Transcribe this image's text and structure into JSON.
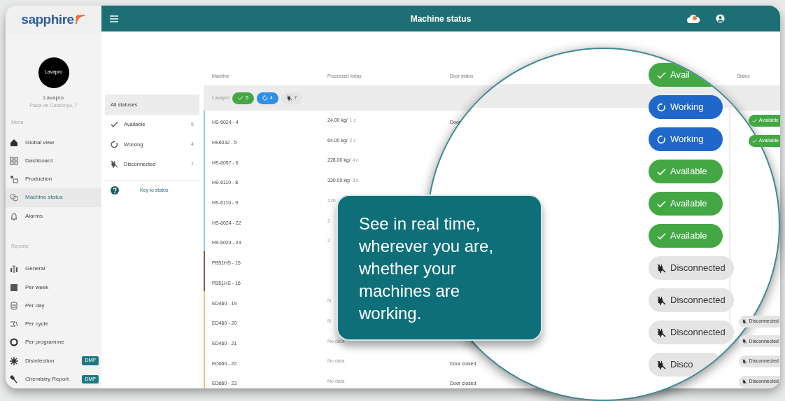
{
  "app": {
    "logo": "sapphire"
  },
  "header": {
    "title": "Machine status"
  },
  "account": {
    "avatar_label": "Lavapro",
    "name": "Lavapro",
    "address": "Plaça de Catalunya, 7"
  },
  "sidebar": {
    "sections": [
      {
        "title": "Menu",
        "items": [
          {
            "label": "Global view",
            "selected": false
          },
          {
            "label": "Dashboard",
            "selected": false
          },
          {
            "label": "Production",
            "selected": false
          },
          {
            "label": "Machine status",
            "selected": true
          },
          {
            "label": "Alarms",
            "selected": false
          }
        ]
      },
      {
        "title": "Reports",
        "items": [
          {
            "label": "General",
            "selected": false
          },
          {
            "label": "Per week",
            "selected": false
          },
          {
            "label": "Per day",
            "selected": false
          },
          {
            "label": "Per cycle",
            "selected": false
          },
          {
            "label": "Per programme",
            "selected": false
          },
          {
            "label": "Disinfection",
            "badge": "DMP",
            "selected": false
          },
          {
            "label": "Chemistry Report",
            "badge": "DMP",
            "selected": false
          }
        ]
      }
    ]
  },
  "filter": {
    "items": [
      {
        "label": "All statuses",
        "kind": "all",
        "selected": true
      },
      {
        "label": "Available",
        "kind": "available",
        "count": "5",
        "selected": false
      },
      {
        "label": "Working",
        "kind": "working",
        "count": "4",
        "selected": false
      },
      {
        "label": "Disconnected",
        "kind": "disconnected",
        "count": "7",
        "selected": false
      }
    ],
    "help": "Key to status"
  },
  "table": {
    "columns": [
      "Machine",
      "Processed today",
      "Door status",
      "Status"
    ],
    "group": {
      "name": "Lavapro",
      "chips": [
        {
          "kind": "available",
          "count": "5"
        },
        {
          "kind": "working",
          "count": "4"
        },
        {
          "kind": "disconnected",
          "count": "7"
        }
      ]
    },
    "rows": [
      {
        "machine": "HS-6024 - 4",
        "processed": "24.00 kg/",
        "cycles": "1 c",
        "door": "Door",
        "status": {
          "kind": "available",
          "label": "Available"
        },
        "color": "#90c4f0"
      },
      {
        "machine": "HS6032 - 5",
        "processed": "64.00 kg/",
        "cycles": "2 c",
        "status": {
          "kind": "available",
          "label": "Available"
        },
        "color": "#90c4f0"
      },
      {
        "machine": "HS-6057 - 6",
        "processed": "228.00 kg/",
        "cycles": "4 c",
        "color": "#90c4f0"
      },
      {
        "machine": "HS-6110 - 8",
        "processed": "330.00 kg/",
        "cycles": "3 c",
        "color": "#90c4f0"
      },
      {
        "machine": "HS-6110 - 9",
        "processed": "220",
        "color": "#90c4f0"
      },
      {
        "machine": "HS-6024 - 22",
        "processed": "2",
        "color": "#90c4f0"
      },
      {
        "machine": "HS-6024 - 23",
        "processed": "2",
        "color": "#90c4f0"
      },
      {
        "machine": "PB51HS - 15",
        "color": "#7a5c55"
      },
      {
        "machine": "PB51HS - 16",
        "color": "#7a5c55"
      },
      {
        "machine": "ED460 - 19",
        "processed": "N",
        "color": "#f2c27a"
      },
      {
        "machine": "ED460 - 20",
        "processed": "N",
        "status": {
          "kind": "disconnected",
          "label": "Disconnected"
        },
        "color": "#f2c27a"
      },
      {
        "machine": "ED460 - 21",
        "processed": "No data",
        "status": {
          "kind": "disconnected",
          "label": "Disconnected"
        },
        "color": "#f2c27a"
      },
      {
        "machine": "ED660 - 22",
        "processed": "No data",
        "door": "Door closed",
        "status": {
          "kind": "disconnected",
          "label": "Disconnected"
        },
        "color": "#f2c27a"
      },
      {
        "machine": "ED660 - 23",
        "processed": "No data",
        "door": "Door closed",
        "status": {
          "kind": "disconnected",
          "label": "Disconnected"
        },
        "color": "#f2c27a"
      }
    ]
  },
  "magnifier": {
    "statuses": [
      {
        "kind": "available",
        "label": "Avail"
      },
      {
        "kind": "working",
        "label": "Working"
      },
      {
        "kind": "working",
        "label": "Working"
      },
      {
        "kind": "available",
        "label": "Available"
      },
      {
        "kind": "available",
        "label": "Available"
      },
      {
        "kind": "available",
        "label": "Available"
      },
      {
        "kind": "disconnected",
        "label": "Disconnected"
      },
      {
        "kind": "disconnected",
        "label": "Disconnected"
      },
      {
        "kind": "disconnected",
        "label": "Disconnected"
      },
      {
        "kind": "disconnected",
        "label": "Disco"
      }
    ]
  },
  "callout": {
    "text": "See in real time, wherever you are, whether your machines are working."
  }
}
